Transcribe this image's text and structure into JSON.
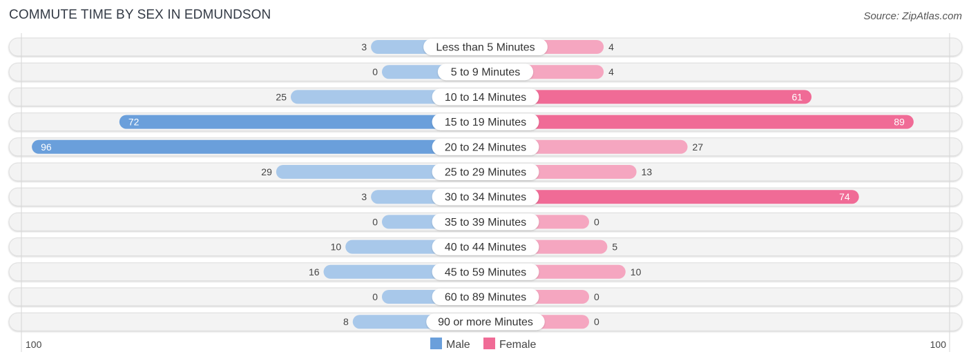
{
  "header": {
    "title": "COMMUTE TIME BY SEX IN EDMUNDSON",
    "source": "Source: ZipAtlas.com"
  },
  "colors": {
    "male_strong": "#6a9fdb",
    "male_light": "#a8c8ea",
    "female_strong": "#f06b96",
    "female_light": "#f5a6c0",
    "row_bg": "#f3f3f3",
    "label_bg": "#ffffff"
  },
  "chart_data": {
    "type": "bar",
    "orientation": "horizontal-diverging",
    "title": "COMMUTE TIME BY SEX IN EDMUNDSON",
    "categories": [
      "Less than 5 Minutes",
      "5 to 9 Minutes",
      "10 to 14 Minutes",
      "15 to 19 Minutes",
      "20 to 24 Minutes",
      "25 to 29 Minutes",
      "30 to 34 Minutes",
      "35 to 39 Minutes",
      "40 to 44 Minutes",
      "45 to 59 Minutes",
      "60 to 89 Minutes",
      "90 or more Minutes"
    ],
    "series": [
      {
        "name": "Male",
        "values": [
          3,
          0,
          25,
          72,
          96,
          29,
          3,
          0,
          10,
          16,
          0,
          8
        ]
      },
      {
        "name": "Female",
        "values": [
          4,
          4,
          61,
          89,
          27,
          13,
          74,
          0,
          5,
          10,
          0,
          0
        ]
      }
    ],
    "axis": {
      "left_label": "100",
      "right_label": "100",
      "max": 100
    },
    "legend": {
      "position": "bottom-center",
      "entries": [
        "Male",
        "Female"
      ]
    }
  }
}
